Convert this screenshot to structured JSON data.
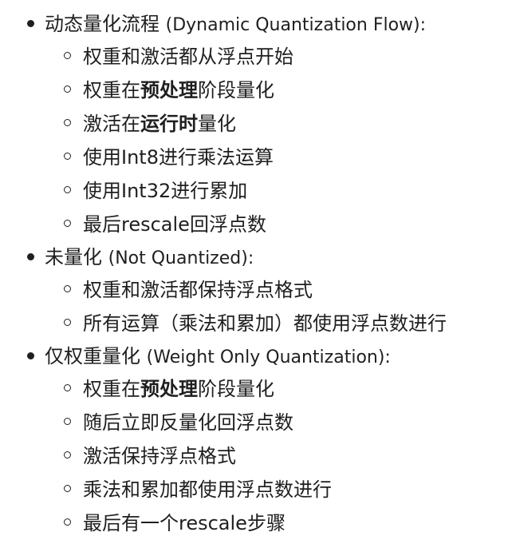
{
  "sections": [
    {
      "title_zh": "动态量化流程",
      "title_en": "(Dynamic Quantization Flow):",
      "items": [
        {
          "pre": "权重和激活都从浮点开始",
          "bold": "",
          "post": ""
        },
        {
          "pre": "权重在",
          "bold": "预处理",
          "post": "阶段量化"
        },
        {
          "pre": "激活在",
          "bold": "运行时",
          "post": "量化"
        },
        {
          "pre": "使用Int8进行乘法运算",
          "bold": "",
          "post": ""
        },
        {
          "pre": "使用Int32进行累加",
          "bold": "",
          "post": ""
        },
        {
          "pre": "最后rescale回浮点数",
          "bold": "",
          "post": ""
        }
      ]
    },
    {
      "title_zh": "未量化",
      "title_en": "(Not Quantized):",
      "items": [
        {
          "pre": "权重和激活都保持浮点格式",
          "bold": "",
          "post": ""
        },
        {
          "pre": "所有运算（乘法和累加）都使用浮点数进行",
          "bold": "",
          "post": ""
        }
      ]
    },
    {
      "title_zh": "仅权重量化",
      "title_en": "(Weight Only Quantization):",
      "items": [
        {
          "pre": "权重在",
          "bold": "预处理",
          "post": "阶段量化"
        },
        {
          "pre": "随后立即反量化回浮点数",
          "bold": "",
          "post": ""
        },
        {
          "pre": "激活保持浮点格式",
          "bold": "",
          "post": ""
        },
        {
          "pre": "乘法和累加都使用浮点数进行",
          "bold": "",
          "post": ""
        },
        {
          "pre": "最后有一个rescale步骤",
          "bold": "",
          "post": ""
        }
      ]
    }
  ]
}
